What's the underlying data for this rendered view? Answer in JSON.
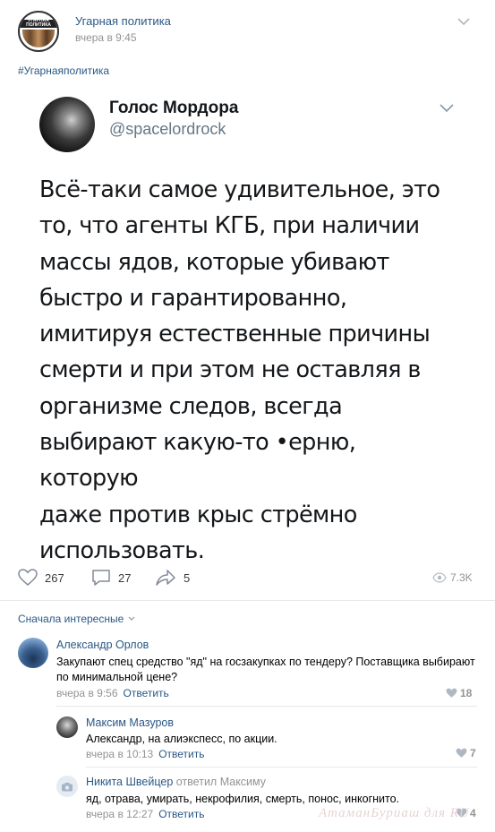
{
  "post": {
    "group_name": "Угарная политика",
    "group_logo_text": "УГАРНАЯ ПОЛИТИКА",
    "time": "вчера в 9:45",
    "hashtag": "#Угарнаяполитика",
    "menu_icon": "chevron-down-icon"
  },
  "tweet": {
    "author": "Голос Мордора",
    "handle": "@spacelordrock",
    "text": "Всё-таки самое удивительное, это\nто, что агенты КГБ, при наличии\nмассы ядов, которые убивают\nбыстро и гарантированно,\nимитируя естественные причины\nсмерти и при этом не оставляя в\nорганизме следов, всегда\nвыбирают какую-то •ерню, которую\nдаже против крыс стрёмно\nиспользовать."
  },
  "stats": {
    "likes": "267",
    "comments": "27",
    "shares": "5",
    "views": "7.3K"
  },
  "comments_section": {
    "sort_label": "Сначала интересные",
    "comments": [
      {
        "author": "Александр Орлов",
        "text": "Закупают спец средство \"яд\" на госзакупках по тендеру? Поставщика выбирают по минимальной цене?",
        "time": "вчера в 9:56",
        "reply_label": "Ответить",
        "likes": "18"
      },
      {
        "author": "Максим Мазуров",
        "text": "Александр, на алиэкспесс, по акции.",
        "time": "вчера в 10:13",
        "reply_label": "Ответить",
        "likes": "7"
      },
      {
        "author": "Никита Швейцер",
        "replied_to": "ответил Максиму",
        "text": "яд, отрава, умирать, некрофилия, смерть, понос, инкогнито.",
        "time": "вчера в 12:27",
        "reply_label": "Ответить",
        "likes": "4"
      }
    ]
  },
  "watermark": "АтаманБуриаш для RU",
  "colors": {
    "link": "#2a5885",
    "muted": "#939393",
    "tweet_text": "#14171a"
  }
}
